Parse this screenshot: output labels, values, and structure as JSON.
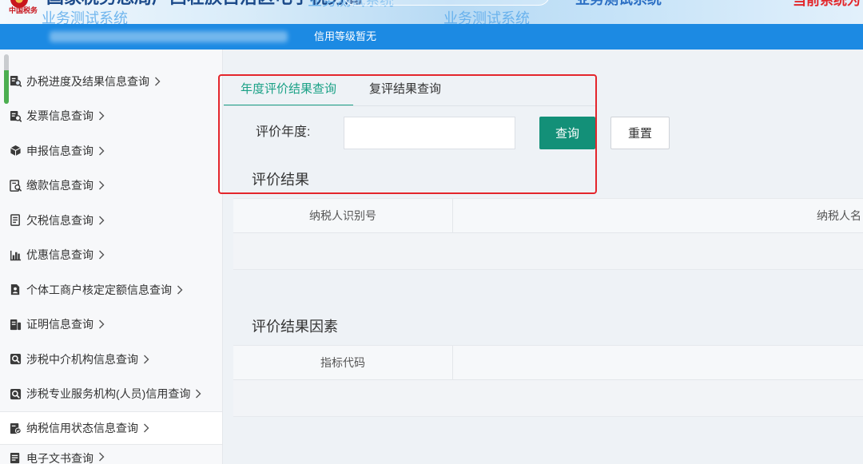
{
  "header": {
    "logo_text": "中国税务",
    "title": "国家税务总局广西壮族自治区电子税务局",
    "watermark": "业务测试系统",
    "notice": "当前系统为"
  },
  "userbar": {
    "credit_level": "信用等级暂无"
  },
  "sidebar": {
    "active_index": 10,
    "items": [
      {
        "label": "办税进度及结果信息查询",
        "icon": "doc-search-icon"
      },
      {
        "label": "发票信息查询",
        "icon": "invoice-search-icon"
      },
      {
        "label": "申报信息查询",
        "icon": "declaration-icon"
      },
      {
        "label": "缴款信息查询",
        "icon": "payment-search-icon"
      },
      {
        "label": "欠税信息查询",
        "icon": "arrears-doc-icon"
      },
      {
        "label": "优惠信息查询",
        "icon": "bar-chart-icon"
      },
      {
        "label": "个体工商户核定定额信息查询",
        "icon": "household-doc-icon"
      },
      {
        "label": "证明信息查询",
        "icon": "certificate-icon"
      },
      {
        "label": "涉税中介机构信息查询",
        "icon": "agency-search-icon"
      },
      {
        "label": "涉税专业服务机构(人员)信用查询",
        "icon": "service-agency-icon"
      },
      {
        "label": "纳税信用状态信息查询",
        "icon": "credit-status-icon"
      },
      {
        "label": "电子文书查询",
        "icon": "e-document-icon"
      }
    ]
  },
  "tabs": [
    {
      "label": "年度评价结果查询",
      "active": true
    },
    {
      "label": "复评结果查询",
      "active": false
    }
  ],
  "form": {
    "year_label": "评价年度:",
    "year_value": "",
    "query_button": "查询",
    "reset_button": "重置"
  },
  "results": {
    "title": "评价结果",
    "columns": [
      "纳税人识别号",
      "纳税人名"
    ],
    "rows": []
  },
  "factors": {
    "title": "评价结果因素",
    "columns": [
      "指标代码"
    ],
    "rows": []
  },
  "colors": {
    "brand_blue": "#1c8ae3",
    "tab_active": "#1aa186",
    "query_button": "#139078",
    "highlight_frame": "#e4262c",
    "notice_red": "#e3262a"
  }
}
